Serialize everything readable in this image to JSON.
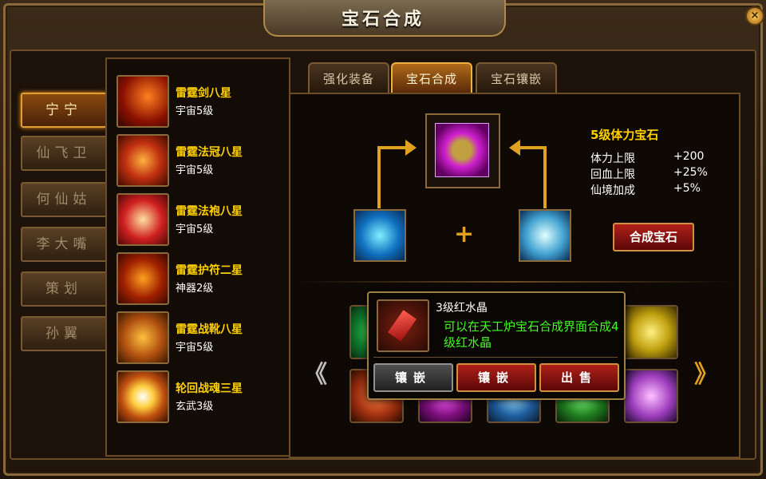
{
  "window": {
    "title": "宝石合成",
    "close_label": "×"
  },
  "characters": [
    {
      "label": "宁宁",
      "active": true
    },
    {
      "label": "仙飞卫",
      "active": false
    },
    {
      "label": "何仙姑",
      "active": false
    },
    {
      "label": "李大嘴",
      "active": false
    },
    {
      "label": "策划",
      "active": false
    },
    {
      "label": "孙翼",
      "active": false
    }
  ],
  "equipment": [
    {
      "name": "雷霆剑八星",
      "level": "宇宙5级",
      "icon": "sword-icon"
    },
    {
      "name": "雷霆法冠八星",
      "level": "宇宙5级",
      "icon": "crown-icon"
    },
    {
      "name": "雷霆法袍八星",
      "level": "宇宙5级",
      "icon": "robe-icon"
    },
    {
      "name": "雷霆护符二星",
      "level": "神器2级",
      "icon": "amulet-icon"
    },
    {
      "name": "雷霆战靴八星",
      "level": "宇宙5级",
      "icon": "boots-icon"
    },
    {
      "name": "轮回战魂三星",
      "level": "玄武3级",
      "icon": "soul-icon"
    }
  ],
  "tabs": [
    {
      "label": "强化装备",
      "active": false
    },
    {
      "label": "宝石合成",
      "active": true
    },
    {
      "label": "宝石镶嵌",
      "active": false
    }
  ],
  "synthesis": {
    "result_name": "5级体力宝石",
    "stats": [
      {
        "label": "体力上限",
        "value": "+200"
      },
      {
        "label": "回血上限",
        "value": "+25%"
      },
      {
        "label": "仙境加成",
        "value": "+5%"
      }
    ],
    "plus_symbol": "+",
    "button_label": "合成宝石"
  },
  "popup": {
    "item_name": "3级红水晶",
    "description": "可以在天工炉宝石合成界面合成4级红水晶",
    "buttons": [
      "镶嵌",
      "镶嵌",
      "出售"
    ]
  },
  "nav": {
    "prev": "《",
    "next": "》"
  },
  "colors": {
    "gold": "#ffd000",
    "green_text": "#40ff20",
    "accent_orange": "#e0a020",
    "red_button": "#b02018"
  }
}
